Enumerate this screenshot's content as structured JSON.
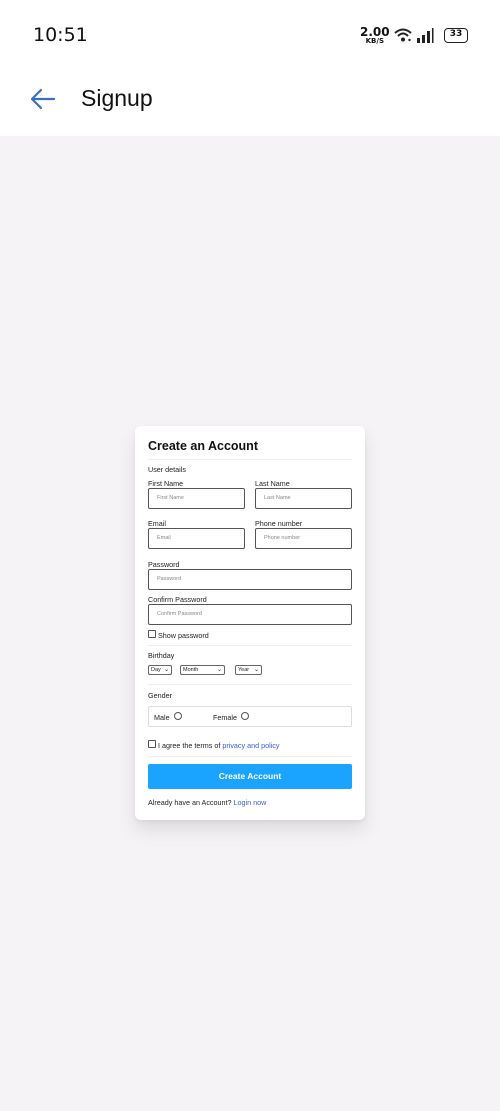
{
  "status_bar": {
    "time": "10:51",
    "net_speed_value": "2.00",
    "net_speed_unit": "KB/S",
    "battery": "33"
  },
  "app_bar": {
    "title": "Signup",
    "back_icon": "arrow-left-icon"
  },
  "form": {
    "title": "Create an Account",
    "section_user_details": "User details",
    "first_name": {
      "label": "First Name",
      "placeholder": "First Name"
    },
    "last_name": {
      "label": "Last Name",
      "placeholder": "Last Name"
    },
    "email": {
      "label": "Email",
      "placeholder": "Email"
    },
    "phone": {
      "label": "Phone number",
      "placeholder": "Phone number"
    },
    "password": {
      "label": "Password",
      "placeholder": "Password"
    },
    "confirm_password": {
      "label": "Confirm Password",
      "placeholder": "Confirm Password"
    },
    "show_password_label": "Show password",
    "birthday": {
      "label": "Birthday",
      "day": "Day",
      "month": "Month",
      "year": "Year"
    },
    "gender": {
      "label": "Gender",
      "male": "Male",
      "female": "Female"
    },
    "terms": {
      "prefix": "I agree the terms of ",
      "link": "privacy and policy"
    },
    "submit_label": "Create Account",
    "login_prompt": "Already have an Account?",
    "login_link": "Login now"
  },
  "colors": {
    "accent": "#1aa3ff",
    "back_arrow": "#3a6fc4",
    "background": "#f5f3f5"
  }
}
